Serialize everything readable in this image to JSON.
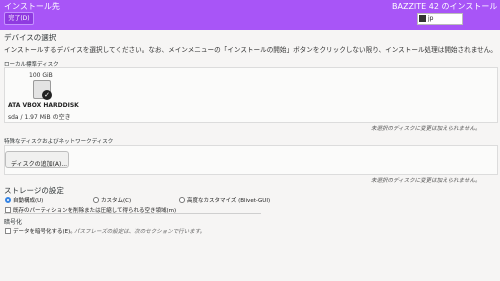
{
  "header": {
    "title": "インストール先",
    "done_label": "完了(D)",
    "product": "BAZZITE 42 のインストール",
    "keyboard": "jp"
  },
  "device_selection": {
    "title": "デバイスの選択",
    "description": "インストールするデバイスを選択してください。なお、メインメニューの「インストールの開始」ボタンをクリックしない限り、インストール処理は開始されません。"
  },
  "local_disks": {
    "title": "ローカル標準ディスク",
    "disks": [
      {
        "size": "100 GiB",
        "name": "ATA VBOX HARDDISK",
        "info": "sda / 1.97 MiB の空き",
        "selected": true
      }
    ],
    "note": "未選択のディスクに変更は加えられません。"
  },
  "special_disks": {
    "title": "特殊なディスクおよびネットワークディスク",
    "add_button": "ディスクの追加(A)...",
    "note": "未選択のディスクに変更は加えられません。"
  },
  "storage_config": {
    "title": "ストレージの設定",
    "options": [
      {
        "label": "自動構成(U)",
        "selected": true
      },
      {
        "label": "カスタム(C)",
        "selected": false
      },
      {
        "label": "高度なカスタマイズ (Blivet-GUI)",
        "selected": false
      }
    ],
    "reclaim_label": "既存のパーティションを削除または圧縮して得られる空き領域(m)"
  },
  "encryption": {
    "title": "暗号化",
    "encrypt_label": "データを暗号化する(E)。",
    "hint": "パスフレーズの設定は、次のセクションで行います。"
  },
  "colors": {
    "header_bg": "#a855f7",
    "accent": "#3584e4"
  }
}
